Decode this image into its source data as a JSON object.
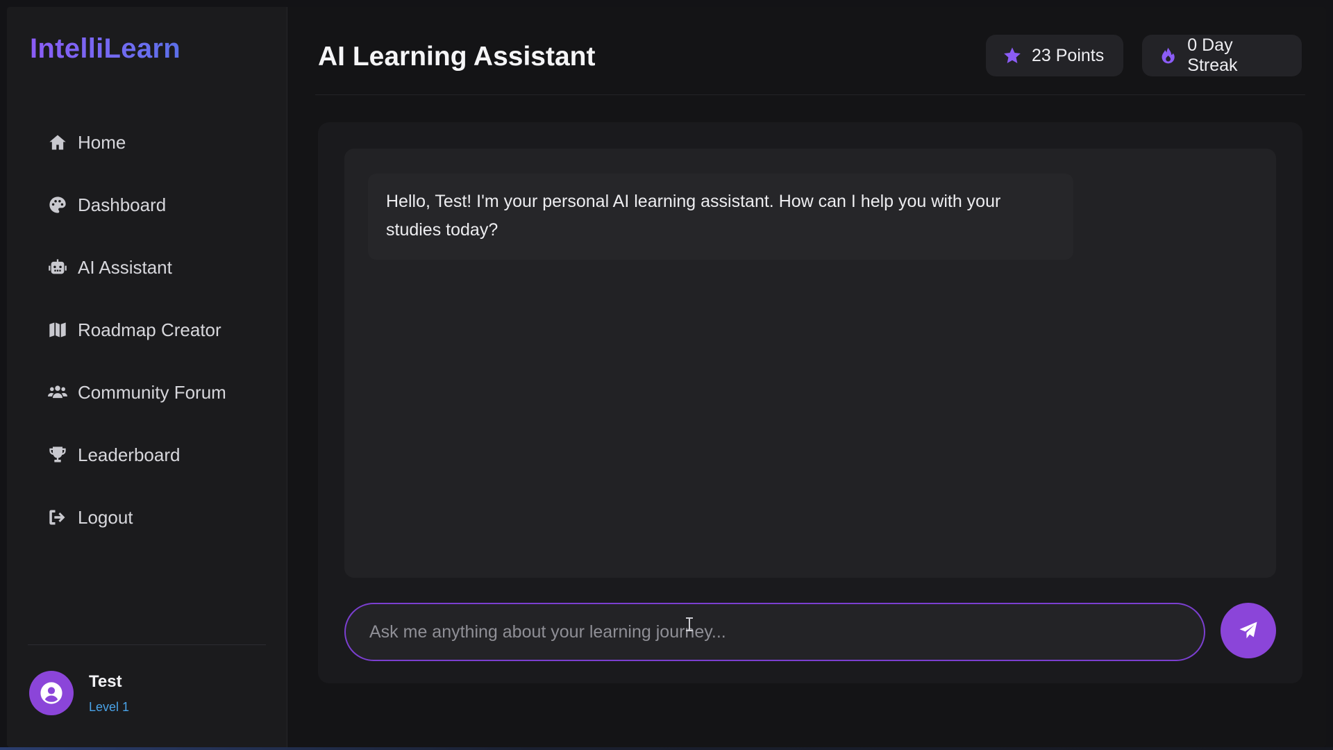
{
  "app": {
    "logo": "IntelliLearn"
  },
  "sidebar": {
    "items": [
      {
        "label": "Home",
        "icon": "home-icon"
      },
      {
        "label": "Dashboard",
        "icon": "palette-icon"
      },
      {
        "label": "AI Assistant",
        "icon": "robot-icon"
      },
      {
        "label": "Roadmap Creator",
        "icon": "map-icon"
      },
      {
        "label": "Community Forum",
        "icon": "users-icon"
      },
      {
        "label": "Leaderboard",
        "icon": "trophy-icon"
      },
      {
        "label": "Logout",
        "icon": "logout-icon"
      }
    ],
    "user": {
      "name": "Test",
      "level": "Level 1"
    }
  },
  "header": {
    "title": "AI Learning Assistant",
    "points": "23 Points",
    "streak": "0 Day Streak"
  },
  "chat": {
    "messages": [
      {
        "role": "assistant",
        "text": "Hello, Test! I'm your personal AI learning assistant. How can I help you with your studies today?"
      }
    ],
    "input_placeholder": "Ask me anything about your learning journey...",
    "input_value": ""
  },
  "colors": {
    "accent": "#8b45d9",
    "accent_light": "#8b5cf6",
    "level_text": "#4aa3e8",
    "background": "#141416"
  }
}
